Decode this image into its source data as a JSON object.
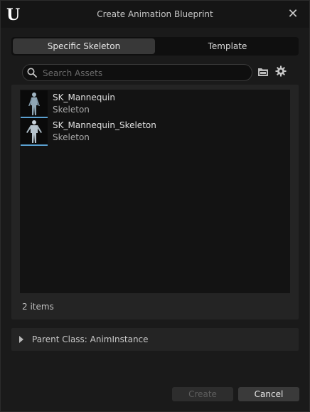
{
  "window": {
    "title": "Create Animation Blueprint",
    "close_glyph": "✕",
    "logo_glyph": "U"
  },
  "tabs": [
    {
      "label": "Specific Skeleton",
      "active": true
    },
    {
      "label": "Template",
      "active": false
    }
  ],
  "search": {
    "placeholder": "Search Assets",
    "value": ""
  },
  "toolbar": {
    "folder_icon": "folder-icon",
    "settings_icon": "gear-icon"
  },
  "assets": [
    {
      "name": "SK_Mannequin",
      "type": "Skeleton",
      "thumbnail": "mannequin-female"
    },
    {
      "name": "SK_Mannequin_Skeleton",
      "type": "Skeleton",
      "thumbnail": "mannequin-male"
    }
  ],
  "item_count": "2 items",
  "parent_class": {
    "label": "Parent Class: AnimInstance",
    "expanded": false
  },
  "buttons": {
    "create": "Create",
    "cancel": "Cancel"
  },
  "colors": {
    "background": "#1a1a1a",
    "panel": "#242424",
    "list_bg": "#131313",
    "thumbnail_underline": "#5aa0d0",
    "disabled_text": "#5e5e5e"
  }
}
